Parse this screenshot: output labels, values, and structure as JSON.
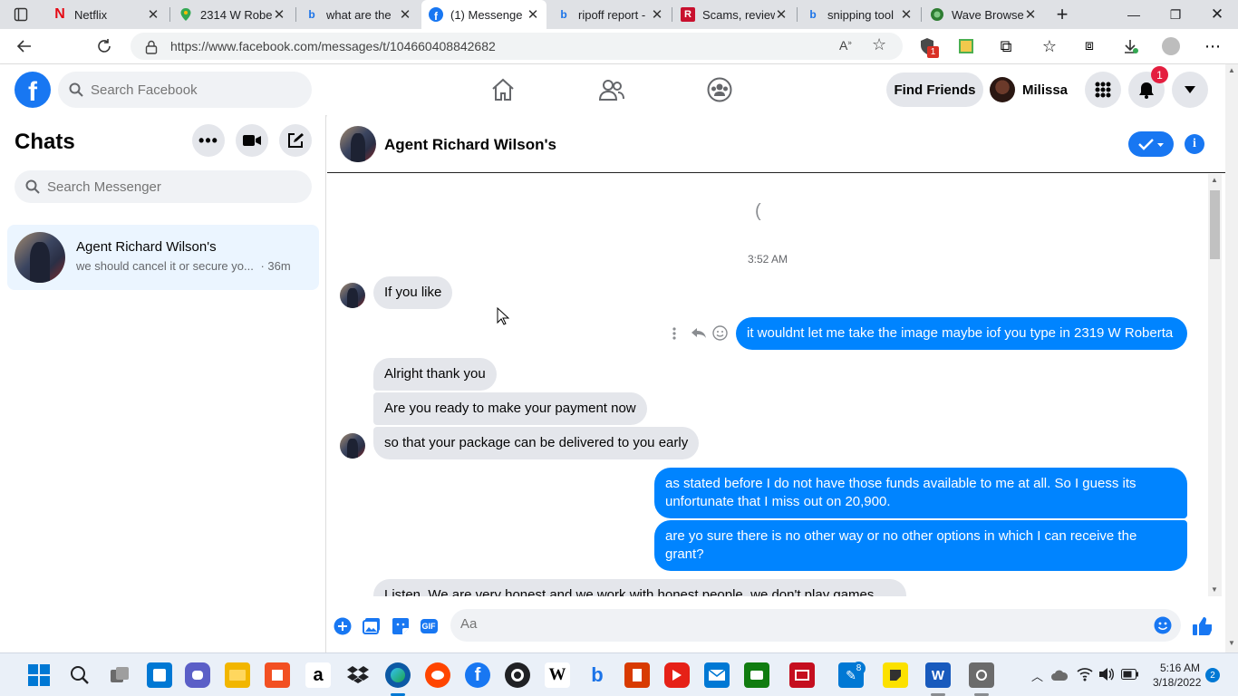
{
  "browser": {
    "tabs": [
      {
        "label": "Netflix",
        "icon": "netflix-icon",
        "color": "#e50914"
      },
      {
        "label": "2314 W Robe",
        "icon": "maps-pin-icon",
        "color": "#34a853"
      },
      {
        "label": "what are the",
        "icon": "bing-icon",
        "color": "#1a73e8"
      },
      {
        "label": "(1) Messenge",
        "icon": "facebook-icon",
        "color": "#1877f2"
      },
      {
        "label": "ripoff report -",
        "icon": "bing-icon",
        "color": "#1a73e8"
      },
      {
        "label": "Scams, review",
        "icon": "ripoff-report-icon",
        "color": "#c8102e"
      },
      {
        "label": "snipping tool",
        "icon": "bing-icon",
        "color": "#1a73e8"
      },
      {
        "label": "Wave Browse",
        "icon": "wave-browser-icon",
        "color": "#2e7d32"
      }
    ],
    "url": "https://www.facebook.com/messages/t/104660408842682",
    "extension_badge": "1"
  },
  "facebook": {
    "search_placeholder": "Search Facebook",
    "find_friends": "Find Friends",
    "user_name": "Milissa",
    "notification_count": "1"
  },
  "sidebar": {
    "title": "Chats",
    "search_placeholder": "Search Messenger",
    "chats": [
      {
        "name": "Agent Richard Wilson's",
        "preview": "we should cancel it or secure yo...",
        "time": "· 36m"
      }
    ]
  },
  "conversation": {
    "contact_name": "Agent Richard Wilson's",
    "loader_glyph": "(",
    "timestamp": "3:52 AM",
    "messages": [
      {
        "from": "them",
        "text": "If you like"
      },
      {
        "from": "me",
        "text": "it wouldnt let me take the image maybe iof you type in 2319 W Roberta"
      },
      {
        "from": "them",
        "text": "Alright thank you"
      },
      {
        "from": "them",
        "text": "Are you ready to make your payment now"
      },
      {
        "from": "them",
        "text": "so that your package can be delivered to you early"
      },
      {
        "from": "me",
        "text": "as stated before I do not have those funds available to me at all. So I guess its unfortunate that I miss out on 20,900."
      },
      {
        "from": "me",
        "text": "are yo sure there is no other way or no other options  in which I can receive the grant?"
      },
      {
        "from": "them",
        "text": "Listen. We are very honest and we work with honest people, we don't play games."
      }
    ],
    "composer_placeholder": "Aa",
    "gif_label": "GIF"
  },
  "taskbar": {
    "time": "5:16 AM",
    "date": "3/18/2022",
    "notification_count": "2",
    "badge_count": "8",
    "amazon_letter": "a",
    "wikipedia_letter": "W"
  },
  "colors": {
    "facebook_blue": "#1877f2",
    "outgoing_bubble": "#0084ff",
    "incoming_bubble": "#e4e6eb"
  }
}
